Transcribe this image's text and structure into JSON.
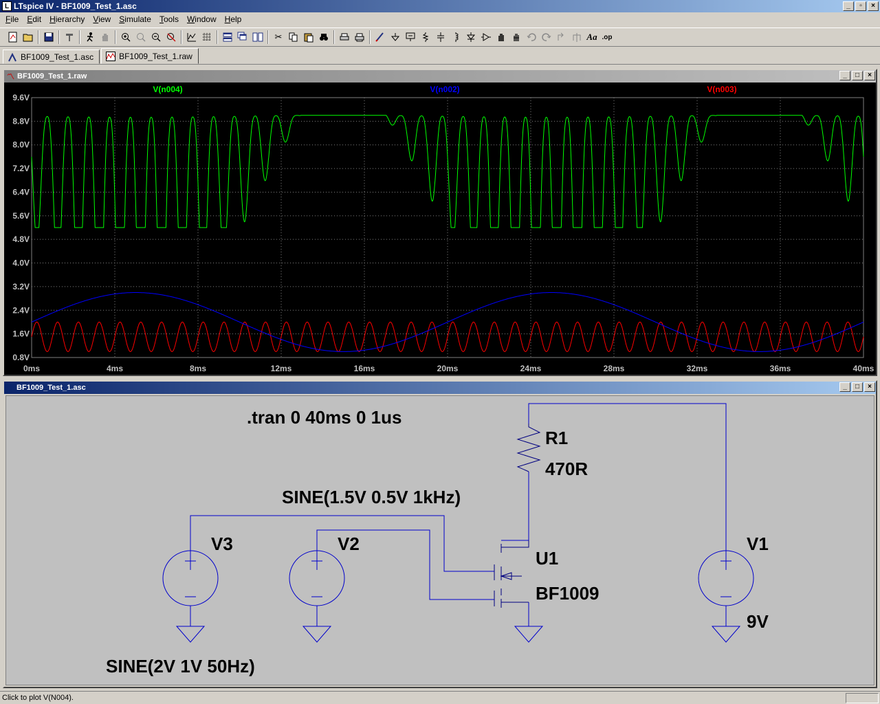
{
  "window": {
    "title": "LTspice IV - BF1009_Test_1.asc",
    "app_icon": "ltspice-icon"
  },
  "menu": [
    "File",
    "Edit",
    "Hierarchy",
    "View",
    "Simulate",
    "Tools",
    "Window",
    "Help"
  ],
  "tabs": [
    {
      "label": "BF1009_Test_1.asc",
      "icon": "schematic-icon"
    },
    {
      "label": "BF1009_Test_1.raw",
      "icon": "waveform-icon"
    }
  ],
  "plot_window": {
    "title": "BF1009_Test_1.raw",
    "traces": [
      {
        "name": "V(n004)",
        "color": "#00ff00"
      },
      {
        "name": "V(n002)",
        "color": "#0000ff"
      },
      {
        "name": "V(n003)",
        "color": "#ff0000"
      }
    ]
  },
  "chart_data": {
    "type": "line",
    "x_ticks": [
      "0ms",
      "4ms",
      "8ms",
      "12ms",
      "16ms",
      "20ms",
      "24ms",
      "28ms",
      "32ms",
      "36ms",
      "40ms"
    ],
    "y_ticks": [
      "9.6V",
      "8.8V",
      "8.0V",
      "7.2V",
      "6.4V",
      "5.6V",
      "4.8V",
      "4.0V",
      "3.2V",
      "2.4V",
      "1.6V",
      "0.8V"
    ],
    "xlim": [
      0,
      40
    ],
    "ylim": [
      0.8,
      9.6
    ],
    "grid": true,
    "series": [
      {
        "name": "V(n004)",
        "color": "#00ff00",
        "note": "amplifier output, 1kHz carrier modulated by 50Hz"
      },
      {
        "name": "V(n002)",
        "color": "#0000ff",
        "offset": 2.0,
        "amplitude": 1.0,
        "freq_hz": 50
      },
      {
        "name": "V(n003)",
        "color": "#ff0000",
        "offset": 1.5,
        "amplitude": 0.5,
        "freq_hz": 1000
      }
    ]
  },
  "schematic_window": {
    "title": "BF1009_Test_1.asc",
    "directive": ".tran 0 40ms 0 1us",
    "r1_name": "R1",
    "r1_value": "470R",
    "v2_value": "SINE(1.5V 0.5V 1kHz)",
    "v3_name": "V3",
    "v2_name": "V2",
    "u1_name": "U1",
    "u1_value": "BF1009",
    "v1_name": "V1",
    "v1_value": "9V",
    "v3_value": "SINE(2V 1V 50Hz)"
  },
  "status": {
    "text": "Click to plot V(N004)."
  }
}
